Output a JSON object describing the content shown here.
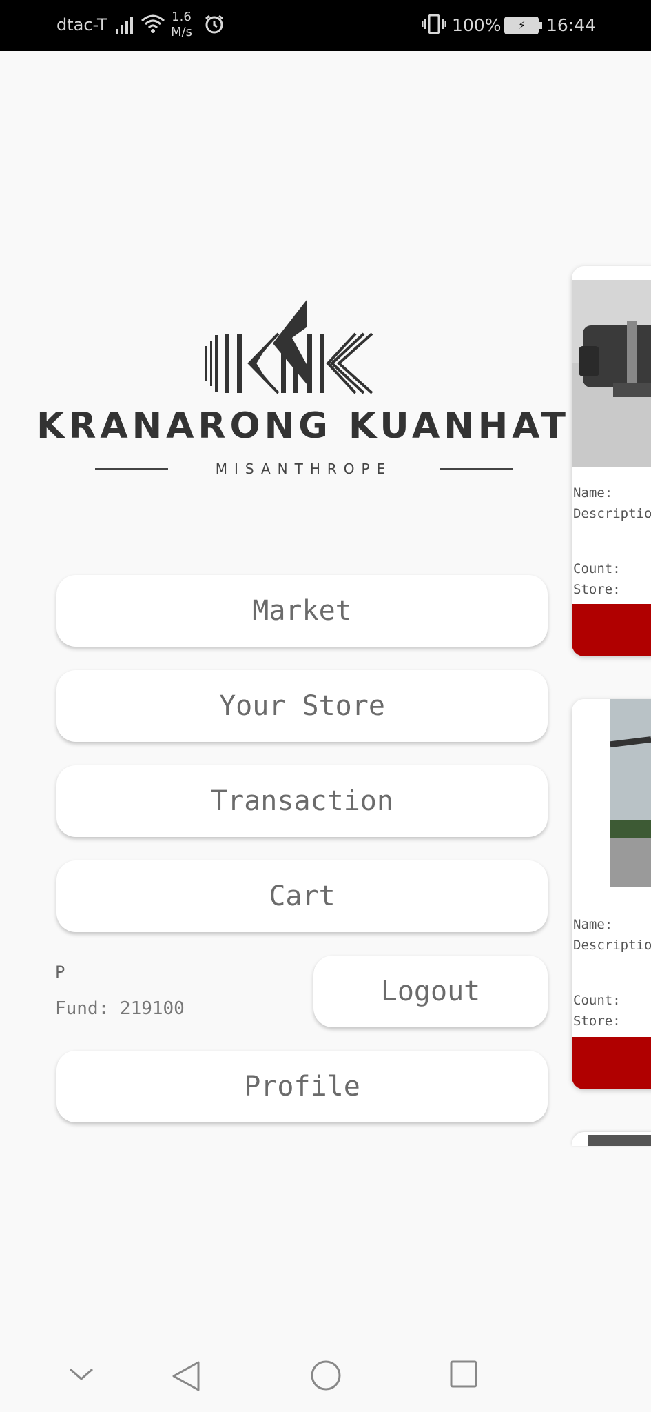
{
  "status_bar": {
    "carrier": "dtac-T",
    "speed_value": "1.6",
    "speed_unit": "M/s",
    "battery_pct": "100%",
    "time": "16:44",
    "icons": [
      "signal-icon",
      "wifi-icon",
      "alarm-icon",
      "vibrate-icon",
      "battery-charging-icon"
    ]
  },
  "logo": {
    "name": "KRANARONG KUANHAT",
    "subtitle": "MISANTHROPE"
  },
  "menu": {
    "market": "Market",
    "your_store": "Your Store",
    "transaction": "Transaction",
    "cart": "Cart",
    "logout": "Logout",
    "profile": "Profile"
  },
  "user": {
    "name": "P",
    "fund": "Fund: 219100"
  },
  "cards": [
    {
      "name_label": "Name:",
      "description_label": "Description",
      "count_label": "Count:",
      "store_label": "Store:"
    },
    {
      "name_label": "Name:",
      "description_label": "Description",
      "count_label": "Count:",
      "store_label": "Store:"
    }
  ],
  "colors": {
    "accent_red": "#b00000",
    "background": "#f9f9f9",
    "button_bg": "#ffffff"
  },
  "nav_bar": {
    "icons": [
      "collapse-chevron-icon",
      "back-icon",
      "home-icon",
      "recents-icon"
    ]
  }
}
